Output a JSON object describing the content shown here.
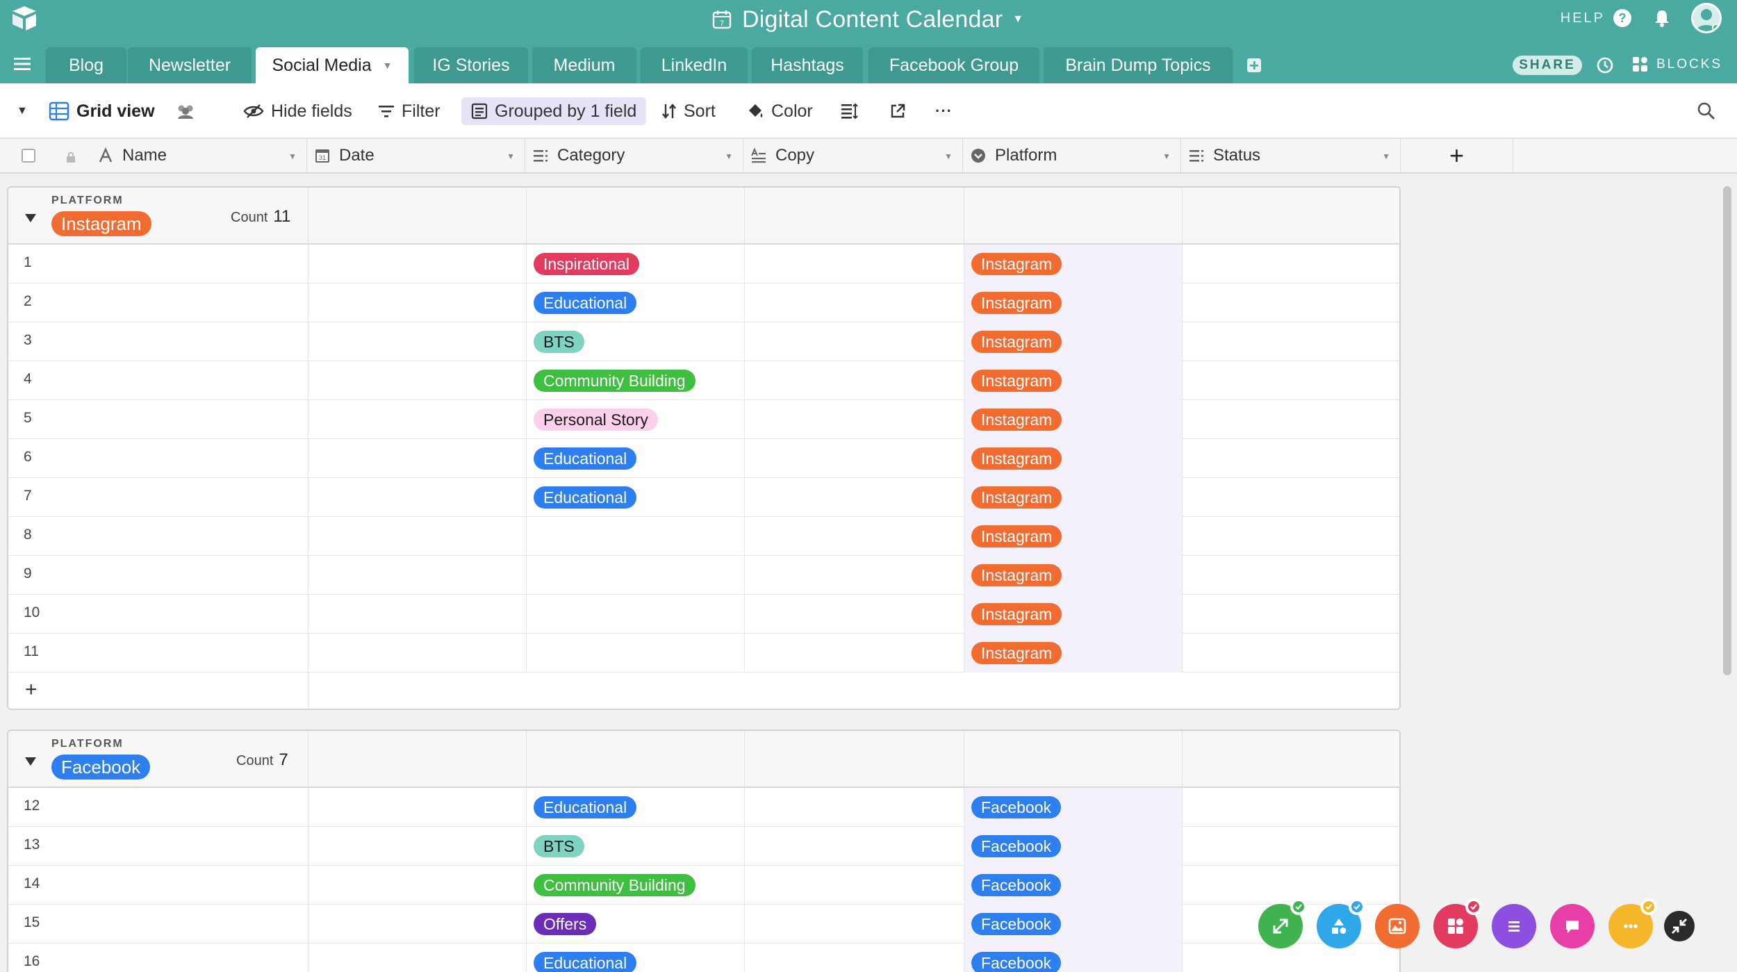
{
  "app": {
    "base_title": "Digital Content Calendar",
    "help_label": "HELP",
    "share_label": "SHARE",
    "blocks_label": "BLOCKS",
    "accent": "#4aa9a0"
  },
  "tabs": [
    {
      "label": "Blog",
      "active": false
    },
    {
      "label": "Newsletter",
      "active": false
    },
    {
      "label": "Social Media",
      "active": true
    },
    {
      "label": "IG Stories",
      "active": false
    },
    {
      "label": "Medium",
      "active": false
    },
    {
      "label": "LinkedIn",
      "active": false
    },
    {
      "label": "Hashtags",
      "active": false
    },
    {
      "label": "Facebook Group",
      "active": false
    },
    {
      "label": "Brain Dump Topics",
      "active": false
    }
  ],
  "toolbar": {
    "view_name": "Grid view",
    "hide_fields": "Hide fields",
    "filter": "Filter",
    "grouped": "Grouped by 1 field",
    "sort": "Sort",
    "color": "Color",
    "more": "···"
  },
  "columns": {
    "name": "Name",
    "date": "Date",
    "category": "Category",
    "copy": "Copy",
    "platform": "Platform",
    "status": "Status",
    "add_field": "+"
  },
  "category_colors": {
    "Inspirational": "#e23b5f",
    "Educational": "#2d7ff0",
    "BTS": "#7fd4c1",
    "Community Building": "#3fbf3f",
    "Personal Story": "#fbd0ea",
    "Offers": "#6b2db8"
  },
  "category_text_colors": {
    "BTS": "#1a1a1a",
    "Personal Story": "#1a1a1a"
  },
  "platform_colors": {
    "Instagram": "#f26b30",
    "Facebook": "#2d7ff0"
  },
  "groups": [
    {
      "field_label": "PLATFORM",
      "value": "Instagram",
      "count_label": "Count",
      "count": "11",
      "add_row": "+",
      "rows": [
        {
          "num": "1",
          "category": "Inspirational",
          "platform": "Instagram"
        },
        {
          "num": "2",
          "category": "Educational",
          "platform": "Instagram"
        },
        {
          "num": "3",
          "category": "BTS",
          "platform": "Instagram"
        },
        {
          "num": "4",
          "category": "Community Building",
          "platform": "Instagram"
        },
        {
          "num": "5",
          "category": "Personal Story",
          "platform": "Instagram"
        },
        {
          "num": "6",
          "category": "Educational",
          "platform": "Instagram"
        },
        {
          "num": "7",
          "category": "Educational",
          "platform": "Instagram"
        },
        {
          "num": "8",
          "category": "",
          "platform": "Instagram"
        },
        {
          "num": "9",
          "category": "",
          "platform": "Instagram"
        },
        {
          "num": "10",
          "category": "",
          "platform": "Instagram"
        },
        {
          "num": "11",
          "category": "",
          "platform": "Instagram"
        }
      ]
    },
    {
      "field_label": "PLATFORM",
      "value": "Facebook",
      "count_label": "Count",
      "count": "7",
      "add_row": "+",
      "rows": [
        {
          "num": "12",
          "category": "Educational",
          "platform": "Facebook"
        },
        {
          "num": "13",
          "category": "BTS",
          "platform": "Facebook"
        },
        {
          "num": "14",
          "category": "Community Building",
          "platform": "Facebook"
        },
        {
          "num": "15",
          "category": "Offers",
          "platform": "Facebook"
        },
        {
          "num": "16",
          "category": "Educational",
          "platform": "Facebook"
        }
      ]
    }
  ],
  "block_buttons": [
    {
      "icon": "expand-icon",
      "color": "#3fb34f",
      "checked": true
    },
    {
      "icon": "shapes-icon",
      "color": "#2fa7e8",
      "checked": true
    },
    {
      "icon": "image-icon",
      "color": "#f26b30",
      "checked": false
    },
    {
      "icon": "blocks-icon",
      "color": "#e23b5f",
      "checked": true
    },
    {
      "icon": "list-icon",
      "color": "#8e4ee0",
      "checked": false
    },
    {
      "icon": "chat-icon",
      "color": "#e83ea8",
      "checked": false
    },
    {
      "icon": "more-icon",
      "color": "#f5b62c",
      "checked": true
    },
    {
      "icon": "collapse-icon",
      "color": "#2a2a2a",
      "checked": false
    }
  ]
}
